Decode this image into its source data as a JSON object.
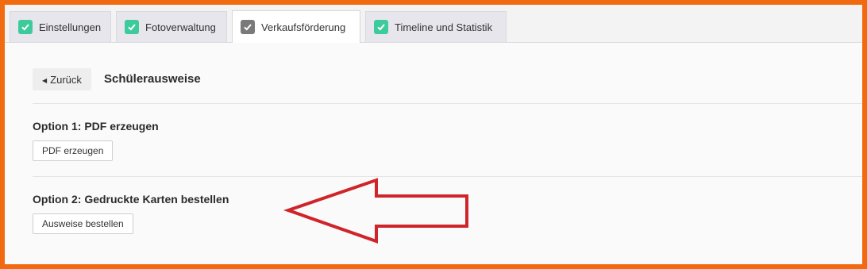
{
  "tabs": [
    {
      "label": "Einstellungen",
      "icon": "check-icon",
      "icon_color": "#3ecb9b",
      "active": false
    },
    {
      "label": "Fotoverwaltung",
      "icon": "check-icon",
      "icon_color": "#3ecb9b",
      "active": false
    },
    {
      "label": "Verkaufsförderung",
      "icon": "check-icon",
      "icon_color": "#7a7a7a",
      "active": true
    },
    {
      "label": "Timeline und Statistik",
      "icon": "check-icon",
      "icon_color": "#3ecb9b",
      "active": false
    }
  ],
  "header": {
    "back_label": "Zurück",
    "title": "Schülerausweise"
  },
  "options": [
    {
      "title": "Option 1: PDF erzeugen",
      "button_label": "PDF erzeugen"
    },
    {
      "title": "Option 2: Gedruckte Karten bestellen",
      "button_label": "Ausweise bestellen"
    }
  ],
  "colors": {
    "frame": "#f26a10",
    "arrow": "#d0242b",
    "check_active": "#3ecb9b",
    "check_inactive": "#7a7a7a"
  },
  "annotation": {
    "type": "arrow-left-icon"
  }
}
